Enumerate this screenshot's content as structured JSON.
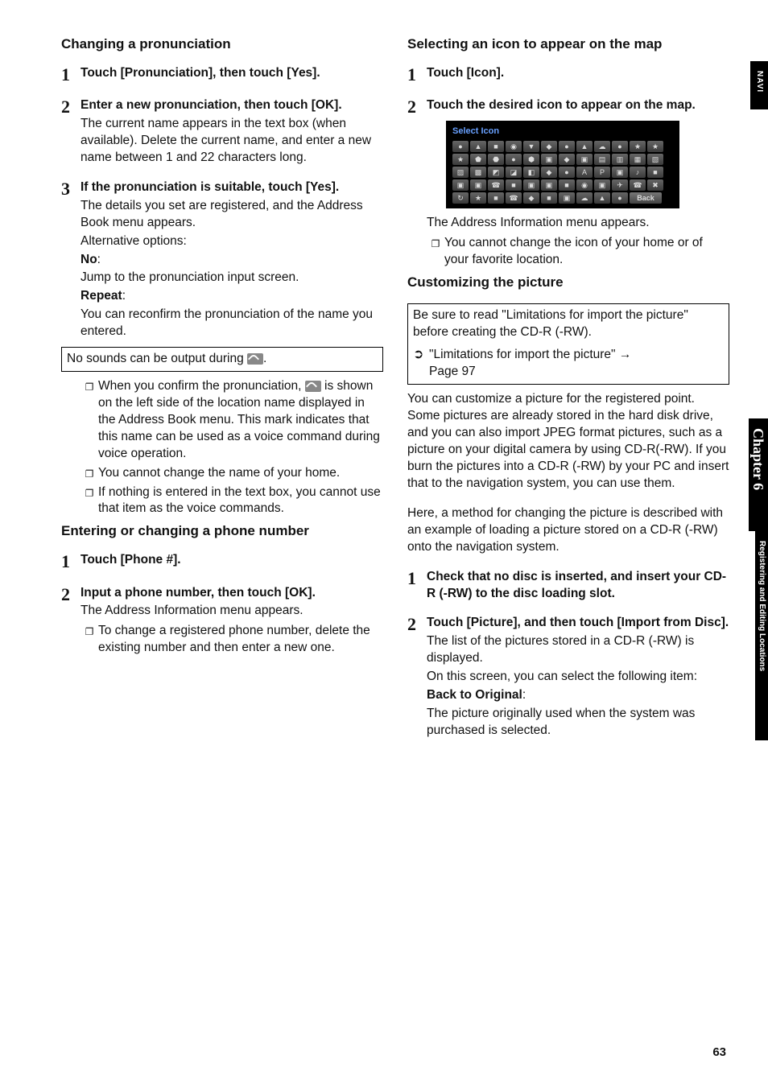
{
  "sidebar": {
    "navi": "NAVI",
    "chapter": "Chapter 6",
    "section": "Registering and Editing Locations"
  },
  "page_number": "63",
  "left": {
    "h_changing": "Changing a pronunciation",
    "s1_head": "Touch [Pronunciation], then touch [Yes].",
    "s2_head": "Enter a new pronunciation, then touch [OK].",
    "s2_text": "The current name appears in the text box (when available). Delete the current name, and enter a new name between 1 and 22 characters long.",
    "s3_head": "If the pronunciation is suitable, touch [Yes].",
    "s3_text": "The details you set are registered, and the Address Book menu appears.",
    "s3_alt": "Alternative options:",
    "s3_no_label": "No",
    "s3_colon": ":",
    "s3_no_text": "Jump to the pronunciation input screen.",
    "s3_repeat_label": "Repeat",
    "s3_repeat_text": "You can reconfirm the pronunciation of the name you entered.",
    "box_nosound_pre": "No sounds can be output during ",
    "box_nosound_post": ".",
    "b1": "When you confirm the pronunciation, ",
    "b1_post": " is shown on the left side of the location name displayed in the Address Book menu. This mark indicates that this name can be used as a voice command during voice operation.",
    "b2": "You cannot change the name of your home.",
    "b3": "If nothing is entered in the text box, you cannot use that item as the voice commands.",
    "h_phone": "Entering or changing a phone number",
    "p1_head": "Touch [Phone #].",
    "p2_head": "Input a phone number, then touch [OK].",
    "p2_text": "The Address Information menu appears.",
    "p2_b1": "To change a registered phone number, delete the existing number and then enter a new one."
  },
  "right": {
    "h_icon": "Selecting an icon to appear on the map",
    "i1_head": "Touch [Icon].",
    "i2_head": "Touch the desired icon to appear on the map.",
    "shot_title": "Select Icon",
    "shot_back": "Back",
    "i_after_text": "The Address Information menu appears.",
    "i_b1": "You cannot change the icon of your home or of your favorite location.",
    "h_custom": "Customizing the picture",
    "box_custom": "Be sure to read \"Limitations for import the picture\" before creating the CD-R (-RW).",
    "ref_text": "\"Limitations for import the picture\" ",
    "ref_page": "Page 97",
    "custom_p1": "You can customize a picture for the registered point. Some pictures are already stored in the hard disk drive, and you can also import JPEG format pictures, such as a picture on your digital camera by using CD-R(-RW). If you burn the pictures into a CD-R (-RW) by your PC and insert that to the navigation system, you can use them.",
    "custom_p2": "Here, a method for changing the picture is described with an example of loading a picture stored on a CD-R (-RW) onto the navigation system.",
    "c1_head": "Check that no disc is inserted, and insert your CD-R (-RW) to the disc loading slot.",
    "c2_head": "Touch [Picture], and then touch [Import from Disc].",
    "c2_text1": "The list of the pictures stored in a CD-R (-RW) is displayed.",
    "c2_text2": "On this screen, you can select the following item:",
    "c2_back_label": "Back to Original",
    "c2_back_text": "The picture originally used when the system was purchased is selected."
  }
}
